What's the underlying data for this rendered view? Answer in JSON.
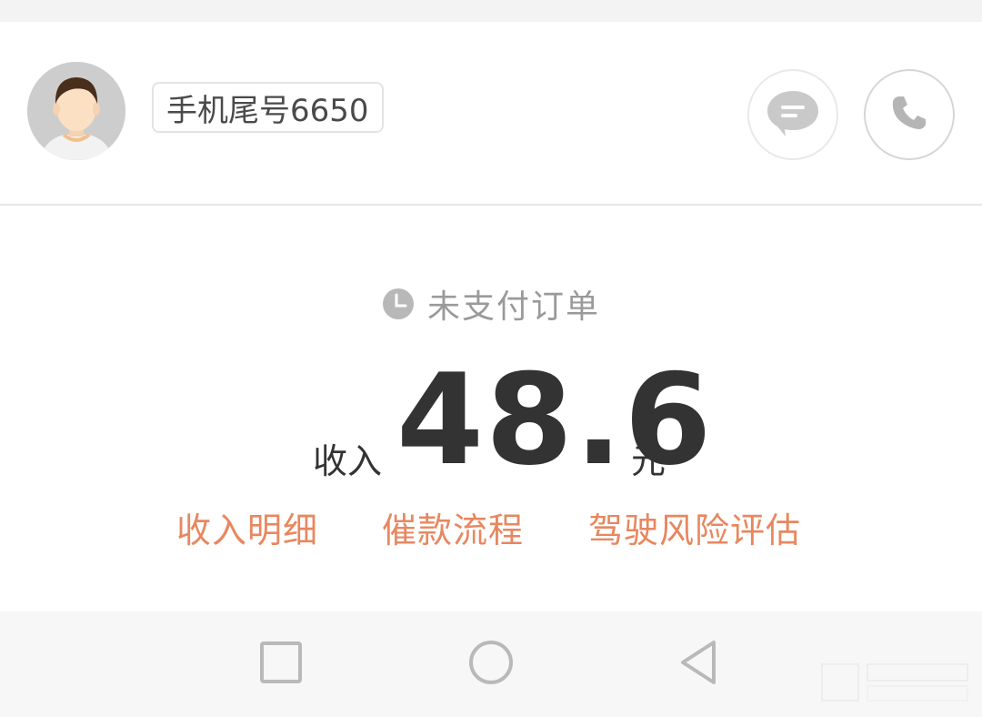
{
  "header": {
    "phone_tag": "手机尾号6650",
    "avatar_icon": "user-avatar-icon",
    "message_icon": "chat-bubble-icon",
    "call_icon": "phone-icon"
  },
  "order": {
    "status_icon": "clock-icon",
    "status_text": "未支付订单",
    "income_label": "收入",
    "amount": "48.6",
    "unit": "元"
  },
  "links": [
    {
      "label": "收入明细"
    },
    {
      "label": "催款流程"
    },
    {
      "label": "驾驶风险评估"
    }
  ],
  "navbar": {
    "recent_icon": "square-icon",
    "home_icon": "circle-icon",
    "back_icon": "triangle-back-icon"
  },
  "colors": {
    "accent": "#e8875f",
    "text_dark": "#333333",
    "text_muted": "#9a9a9a",
    "icon_gray": "#b5b5b5"
  }
}
